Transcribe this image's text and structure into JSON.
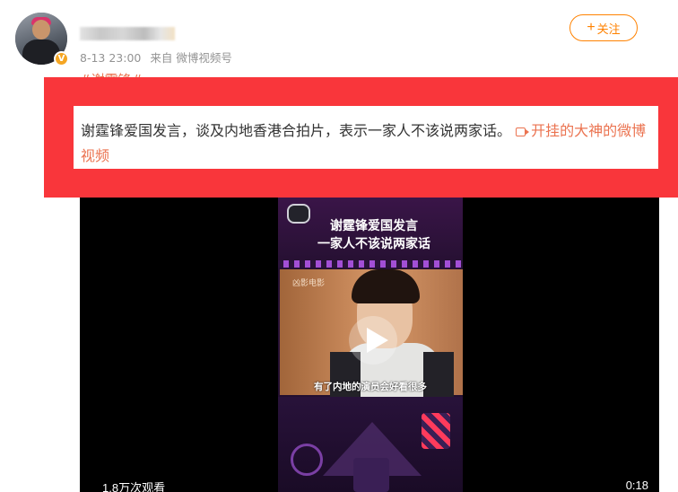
{
  "post": {
    "time": "8-13 23:00",
    "source": "来自 微博视频号",
    "tag_partial": "#谢霆锋#",
    "text": "谢霆锋爱国发言，谈及内地香港合拍片，表示一家人不该说两家话。",
    "link_label": "开挂的大神的微博视频"
  },
  "follow_button": {
    "plus": "+",
    "label": "关注"
  },
  "verify_badge": {
    "glyph": "V",
    "color": "#f5a623"
  },
  "video": {
    "title_line1": "谢霆锋爱国发言",
    "title_line2": "一家人不该说两家话",
    "watermark": "凶影电影",
    "subtitle": "有了内地的演员会好看很多",
    "views": "1.8万次观看",
    "duration": "0:18"
  },
  "colors": {
    "accent": "#ff8200",
    "link": "#eb7350",
    "banner": "#f9363b"
  }
}
